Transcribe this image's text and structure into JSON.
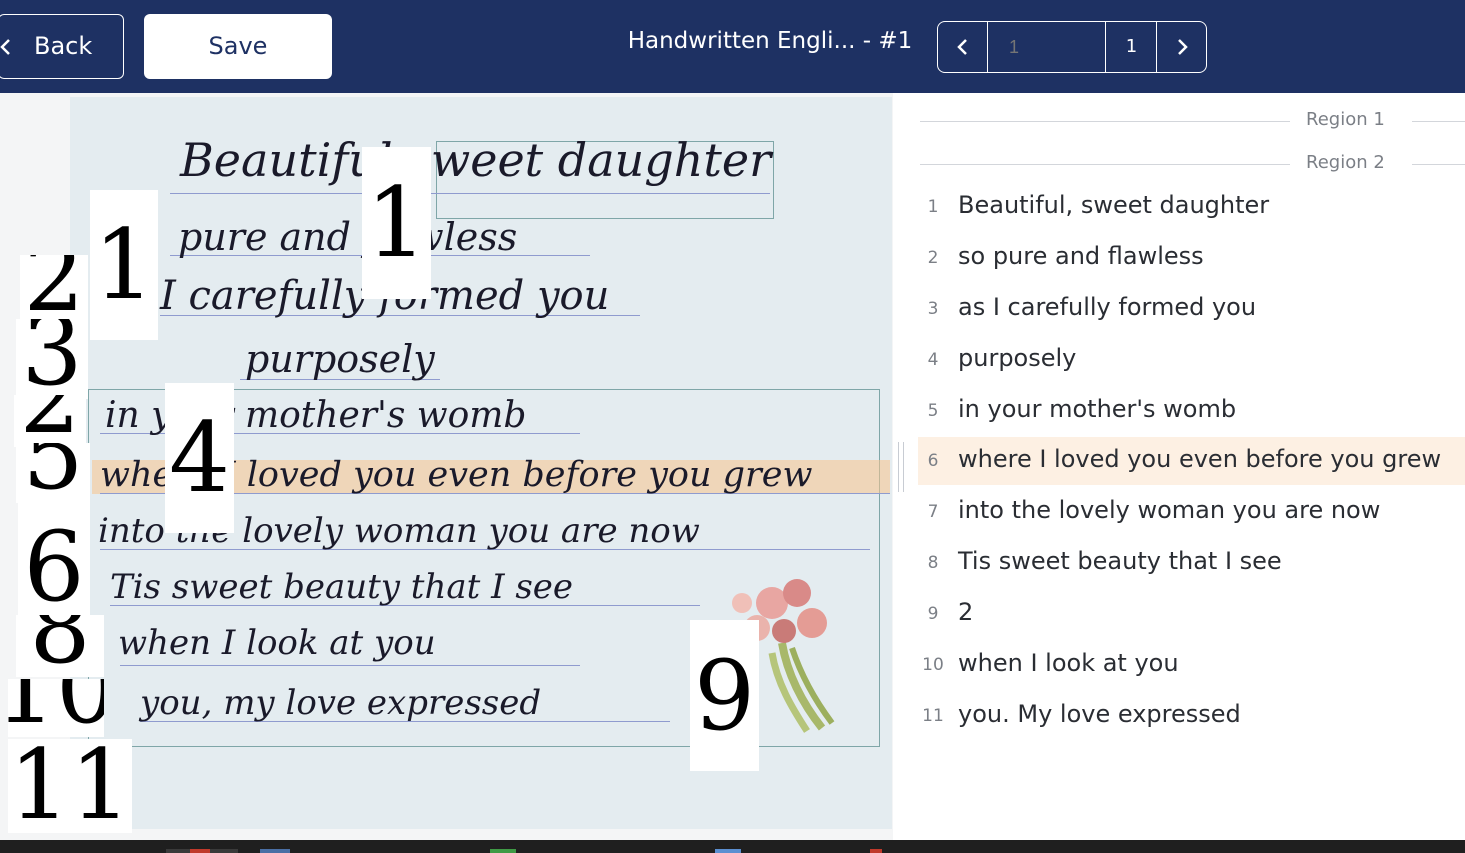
{
  "header": {
    "back_label": "Back",
    "save_label": "Save",
    "doc_title": "Handwritten Engli... - #1",
    "pager": {
      "current_placeholder": "1",
      "total": "1"
    }
  },
  "colors": {
    "header_bg": "#1e3163",
    "active_line": "#fdf0e3",
    "highlight": "#f7c58c"
  },
  "image": {
    "handwriting": [
      "Beautiful sweet daughter",
      "pure and flawless",
      "I carefully formed you",
      "purposely",
      "in your mother's womb",
      "where I loved you even before you grew",
      "into the lovely woman you are now",
      "Tis sweet beauty that I see",
      "when I look at you",
      "you, my love expressed"
    ],
    "tags": [
      "1",
      "1",
      "2",
      "3",
      "2",
      "4",
      "5",
      "6",
      "8",
      "10",
      "9",
      "11"
    ]
  },
  "transcript": {
    "regions": [
      "Region 1",
      "Region 2"
    ],
    "lines": [
      {
        "no": "1",
        "text": "Beautiful, sweet daughter"
      },
      {
        "no": "2",
        "text": "so pure and flawless"
      },
      {
        "no": "3",
        "text": "as I carefully formed you"
      },
      {
        "no": "4",
        "text": "purposely"
      },
      {
        "no": "5",
        "text": "in your mother's womb"
      },
      {
        "no": "6",
        "text": "where I loved you even before you grew",
        "active": true
      },
      {
        "no": "7",
        "text": "into the lovely woman you are now"
      },
      {
        "no": "8",
        "text": "Tis sweet beauty that I see"
      },
      {
        "no": "9",
        "text": "2"
      },
      {
        "no": "10",
        "text": "when I look at you"
      },
      {
        "no": "11",
        "text": "you. My love expressed"
      }
    ]
  }
}
